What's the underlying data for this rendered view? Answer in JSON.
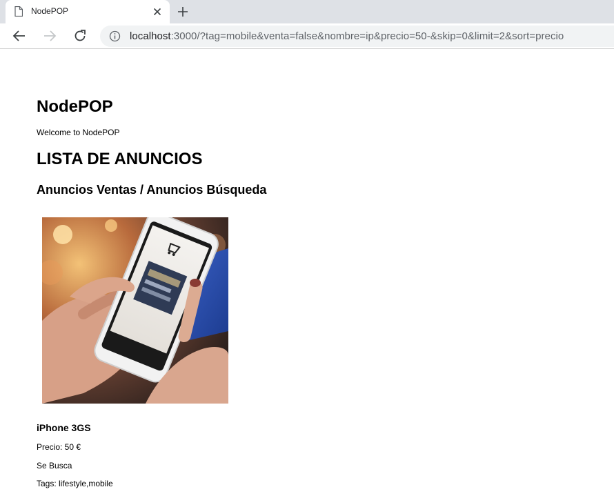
{
  "browser": {
    "tab_title": "NodePOP",
    "url_host": "localhost",
    "url_rest": ":3000/?tag=mobile&venta=false&nombre=ip&precio=50-&skip=0&limit=2&sort=precio"
  },
  "page": {
    "site_title": "NodePOP",
    "welcome": "Welcome to NodePOP",
    "list_title": "LISTA DE ANUNCIOS",
    "list_subtitle": "Anuncios Ventas / Anuncios Búsqueda"
  },
  "ads": [
    {
      "name": "iPhone 3GS",
      "price": "Precio: 50 €",
      "type": "Se Busca",
      "tags_label": "Tags: ",
      "tags": "lifestyle,mobile"
    }
  ],
  "icons": {
    "favicon": "page-icon",
    "close": "close-icon",
    "new_tab": "plus-icon",
    "back": "arrow-left-icon",
    "forward": "arrow-right-icon",
    "reload": "reload-icon",
    "info": "info-icon"
  },
  "colors": {
    "tabstrip": "#dee1e6",
    "omnibox": "#f1f3f4",
    "disabled_icon": "#c4c7c9",
    "icon": "#3c4043"
  }
}
